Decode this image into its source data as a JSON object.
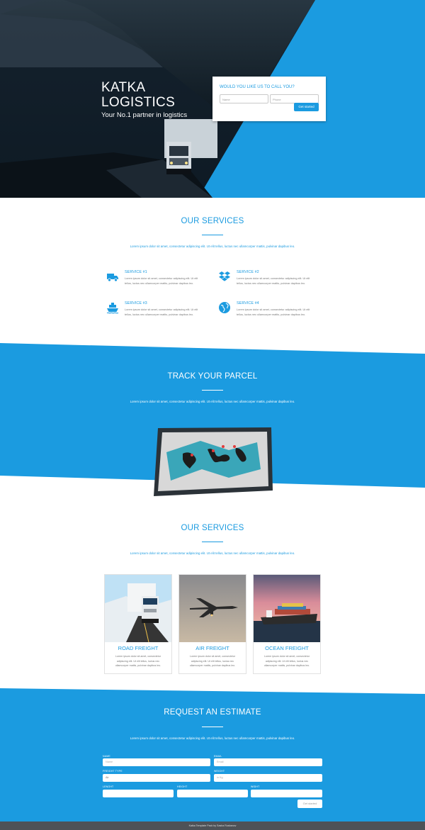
{
  "hero": {
    "title_line1": "KATKA",
    "title_line2": "LOGISTICS",
    "subtitle": "Your No.1 partner in logistics",
    "callbox": {
      "heading": "WOULD YOU LIKE US TO CALL YOU?",
      "name_placeholder": "Name",
      "phone_placeholder": "Phone",
      "button": "Get started"
    }
  },
  "services": {
    "title": "OUR SERVICES",
    "lead": "Lorem ipsum dolor sit amet, consectetur adipiscing elit. Ut elit tellus, luctus nec ullamcorper mattis, pulvinar dapibus leo.",
    "items": [
      {
        "title": "SERVICE #1",
        "icon": "truck-icon",
        "text": "Lorem ipsum dolor sit amet, consectetur adipiscing elit. Ut elit tellus, luctus nec ullamcorper mattis, pulvinar dapibus leo."
      },
      {
        "title": "SERVICE #2",
        "icon": "dropbox-icon",
        "text": "Lorem ipsum dolor sit amet, consectetur adipiscing elit. Ut elit tellus, luctus nec ullamcorper mattis, pulvinar dapibus leo."
      },
      {
        "title": "SERVICE #3",
        "icon": "ship-icon",
        "text": "Lorem ipsum dolor sit amet, consectetur adipiscing elit. Ut elit tellus, luctus nec ullamcorper mattis, pulvinar dapibus leo."
      },
      {
        "title": "SERVICE #4",
        "icon": "globe-icon",
        "text": "Lorem ipsum dolor sit amet, consectetur adipiscing elit. Ut elit tellus, luctus nec ullamcorper mattis, pulvinar dapibus leo."
      }
    ]
  },
  "track": {
    "title": "TRACK YOUR PARCEL",
    "lead": "Lorem ipsum dolor sit amet, consectetur adipiscing elit. Ut elit tellus, luctus nec ullamcorper mattis, pulvinar dapibus leo."
  },
  "freight": {
    "title": "OUR SERVICES",
    "lead": "Lorem ipsum dolor sit amet, consectetur adipiscing elit. Ut elit tellus, luctus nec ullamcorper mattis, pulvinar dapibus leo.",
    "cards": [
      {
        "title": "ROAD FREIGHT",
        "text": "Lorem ipsum dolor sit amet, consectetur adipiscing elit. Ut elit tellus, luctus nec ullamcorper mattis, pulvinar dapibus leo."
      },
      {
        "title": "AIR FREIGHT",
        "text": "Lorem ipsum dolor sit amet, consectetur adipiscing elit. Ut elit tellus, luctus nec ullamcorper mattis, pulvinar dapibus leo."
      },
      {
        "title": "OCEAN FREIGHT",
        "text": "Lorem ipsum dolor sit amet, consectetur adipiscing elit. Ut elit tellus, luctus nec ullamcorper mattis, pulvinar dapibus leo."
      }
    ]
  },
  "estimate": {
    "title": "REQUEST AN ESTIMATE",
    "lead": "Lorem ipsum dolor sit amet, consectetur adipiscing elit. Ut elit tellus, luctus nec ullamcorper mattis, pulvinar dapibus leo.",
    "name_label": "NAME",
    "name_placeholder": "Name",
    "email_label": "EMAIL",
    "email_placeholder": "Email",
    "freight_label": "FREIGHT TYPE",
    "freight_value": "Air",
    "weight_label": "WEIGHT",
    "weight_placeholder": "in Kg",
    "length_label": "LENGHT",
    "height_label": "HEIGHT",
    "width_label": "WIDHT",
    "button": "Get started"
  },
  "footer": {
    "text": "Katka Template Pack by Sasha Rusbanov"
  },
  "colors": {
    "accent": "#1b9be0",
    "footer": "#4e5257"
  }
}
